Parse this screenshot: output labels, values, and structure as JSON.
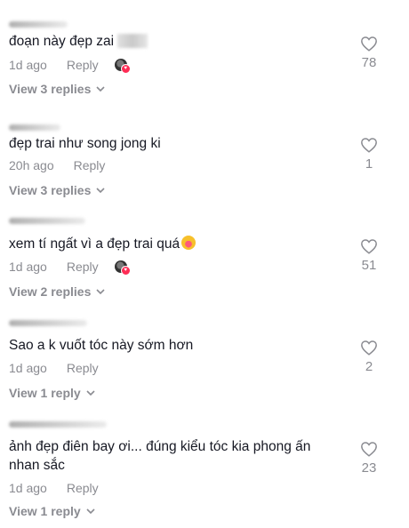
{
  "comments": [
    {
      "text": "đoạn này đẹp zai",
      "time": "1d ago",
      "reply": "Reply",
      "likes": "78",
      "view_replies": "View 3 replies",
      "liked_by_creator": true
    },
    {
      "text": "đẹp trai như song jong ki",
      "time": "20h ago",
      "reply": "Reply",
      "likes": "1",
      "view_replies": "View 3 replies",
      "liked_by_creator": false
    },
    {
      "text": "xem tí ngất vì a đẹp trai quá",
      "time": "1d ago",
      "reply": "Reply",
      "likes": "51",
      "view_replies": "View 2 replies",
      "liked_by_creator": true
    },
    {
      "text": "Sao a k vuốt tóc này sớm hơn",
      "time": "1d ago",
      "reply": "Reply",
      "likes": "2",
      "view_replies": "View 1 reply",
      "liked_by_creator": false
    },
    {
      "text": "ảnh đẹp điên bay ơi... đúng kiểu tóc kia phong ấn nhan sắc",
      "time": "1d ago",
      "reply": "Reply",
      "likes": "23",
      "view_replies": "View 1 reply",
      "liked_by_creator": false
    }
  ],
  "icons": {
    "like": "heart-outline-icon",
    "expand": "chevron-down-icon",
    "creator_like": "creator-liked-badge",
    "emoji": "laughing-emoji-icon"
  },
  "colors": {
    "text": "#161823",
    "secondary": "#8a8b91",
    "creator_heart": "#fe2c55"
  }
}
